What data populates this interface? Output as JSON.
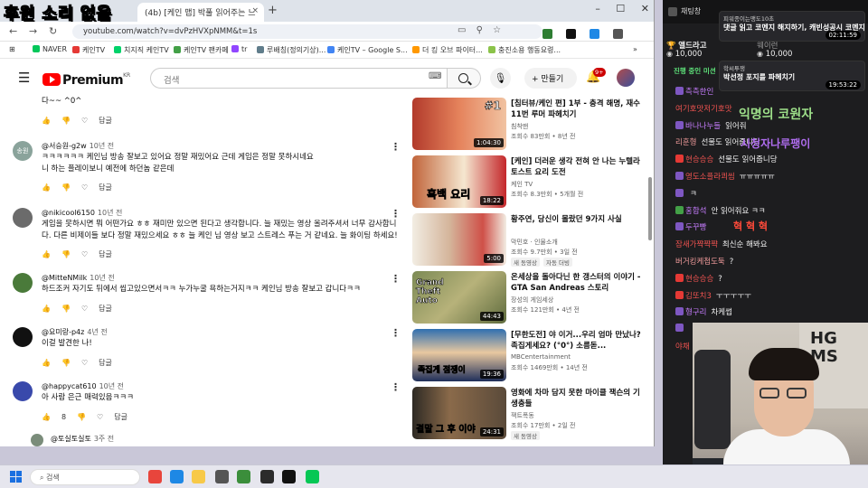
{
  "stream_title": "후원 소리 없음",
  "browser": {
    "tabs": [
      {
        "label": "",
        "close": "×"
      },
      {
        "label": "(4b) [케인 맵] 박풀 읽어주는 느",
        "close": "×"
      }
    ],
    "new_tab": "+",
    "window_controls": [
      "–",
      "☐",
      "✕"
    ],
    "url": "youtube.com/watch?v=dvPzHVXpNMM&t=1s",
    "bookmarks": [
      {
        "label": "NAVER",
        "color": "#03c75a"
      },
      {
        "label": "케인TV",
        "color": "#e53935"
      },
      {
        "label": "치지직 케인TV",
        "color": "#00d26a"
      },
      {
        "label": "케인TV 팬카페",
        "color": "#43a047"
      },
      {
        "label": "tr",
        "color": "#9146ff"
      },
      {
        "label": "루배칭(정의기상)...",
        "color": "#607d8b"
      },
      {
        "label": "케인TV – Google S...",
        "color": "#4285f4"
      },
      {
        "label": "더 킹 오브 파이터...",
        "color": "#ff9800"
      },
      {
        "label": "충진소용 행동요령...",
        "color": "#8bc34a"
      }
    ]
  },
  "youtube": {
    "logo_word": "Premium",
    "logo_region": "KR",
    "search_placeholder": "검색",
    "create_label": "+ 만들기",
    "notif_badge": "9+",
    "like_label": "👍",
    "reply_label": "답글",
    "comments": [
      {
        "author": "",
        "time": "",
        "text": "다~~ ^0^",
        "likes": ""
      },
      {
        "author": "@서승원-g2w",
        "time": "10년 전",
        "text": "ㅋㅋㅋㅋㅋㅋ 케인님 방송 잘보고 있어요 정말 재밌어요 근데 게임은 정말 못하시네요\n니 하는 플레이보니 예전에 하던놈 같은데",
        "likes": ""
      },
      {
        "author": "@nikicool6150",
        "time": "10년 전",
        "text": "게임을 못하시면 뭐 어떤가요 ㅎㅎ 재미만 있으면 된다고 생각합니다. 늘 재밌는 영상 올려주셔서 너무 감사합니다. 다른 비제이들 보다 정말 재밌으세요 ㅎㅎ 늘 케인 님 영상 보고 스트레스 푸는 거 같네요. 늘 화이팅 하세요!",
        "likes": ""
      },
      {
        "author": "@MitteNMilk",
        "time": "10년 전",
        "text": "하드조커 자기도 뒤에서 씹고있으면서ㅋㅋ 누가누굴 욕하는거지ㅋㅋ 케인님 방송 잘보고 갑니다ㅋㅋ",
        "likes": ""
      },
      {
        "author": "@요미랑-p4z",
        "time": "4년 전",
        "text": "이걸 발견한 나!",
        "likes": ""
      },
      {
        "author": "@happycat610",
        "time": "10년 전",
        "text": "아 사람 은근 매력있음ㅋㅋㅋ",
        "likes": "8"
      },
      {
        "author": "@토실토실토",
        "time": "3주 전",
        "text": "",
        "likes": ""
      }
    ],
    "recommendations": [
      {
        "title": "[침터뷰/케인 편] 1부 - 충격 해명, 재수 11번 루머 파헤치기",
        "channel": "침착맨",
        "meta": "조회수 83만회 • 8년 전",
        "duration": "1:04:30",
        "thumb_text": "#1",
        "badges": []
      },
      {
        "title": "[케인] 더러운 생각 전혀 안 나는 누텔라 토스트 요리 도전",
        "channel": "케인 TV",
        "meta": "조회수 8.3만회 • 5개월 전",
        "duration": "18:22",
        "thumb_text": "흑백 요리",
        "badges": []
      },
      {
        "title": "황주연, 당신이 몰랐던 9가지 사실",
        "channel": "막민호 · 인물소개",
        "meta": "조회수 9.7만회 • 3일 전",
        "duration": "5:00",
        "thumb_text": "",
        "badges": [
          "새 동영상",
          "자동 더빙"
        ]
      },
      {
        "title": "온세상을 돌아다닌 한 갱스터의 이야기 - GTA San Andreas 스토리",
        "channel": "장성의 게임세상",
        "meta": "조회수 121만회 • 4년 전",
        "duration": "44:43",
        "thumb_text": "Grand Theft Auto",
        "badges": []
      },
      {
        "title": "[무한도전] 야 이거...우리 엄마 만났나? 족집게세요? (°0°) 소름돋...",
        "channel": "MBCentertainment",
        "meta": "조회수 1469만회 • 14년 전",
        "duration": "19:36",
        "thumb_text": "족집게 점쟁이",
        "badges": []
      },
      {
        "title": "영화에 차마 담지 못한 마이클 잭슨의 기생충들",
        "channel": "잭트폭동",
        "meta": "조회수 17만회 • 2일 전",
        "duration": "24:31",
        "thumb_text": "결말 그 후 이야",
        "badges": [
          "새 동영상"
        ]
      }
    ]
  },
  "taskbar": {
    "search_placeholder": "검색",
    "apps": [
      {
        "name": "chrome",
        "color": "#e8453c"
      },
      {
        "name": "edge",
        "color": "#1e88e5"
      },
      {
        "name": "explorer",
        "color": "#f7c948"
      },
      {
        "name": "photos",
        "color": "#555555"
      },
      {
        "name": "notes",
        "color": "#3b8e3b"
      },
      {
        "name": "obs",
        "color": "#2b2b2b"
      },
      {
        "name": "soop",
        "color": "#111111"
      },
      {
        "name": "line",
        "color": "#06c755"
      }
    ]
  },
  "chat": {
    "header": "채팅창",
    "pinned": [
      {
        "name": "피워종이는맹도10초",
        "msg": "댓글 읽고 코멘지 해지하기, 캐빈성공시 코멘지",
        "time": "02:11:59"
      },
      {
        "name": "학씨투쟁",
        "msg": "박선정 포지를 파헤치기",
        "time": "19:53:22"
      }
    ],
    "donors": [
      {
        "name": "앨드라고",
        "amount": "10,000"
      },
      {
        "name": "웨이런",
        "amount": ""
      },
      {
        "name": "",
        "amount": "10,000"
      }
    ],
    "now_tag": "진행 중인 미션",
    "messages": [
      {
        "name": "측측한인",
        "msg": "",
        "color": "#c77dff",
        "icon": "#7e57c2"
      },
      {
        "name": "여기호맛저기호맛",
        "msg": "",
        "color": "#ef5350",
        "icon": ""
      },
      {
        "name": "바나나누들",
        "msg": "읽어줘",
        "color": "#c77dff",
        "icon": "#7e57c2"
      },
      {
        "name": "리훈형",
        "msg": "선물도 읽어줍니당",
        "color": "#ef9a9a",
        "icon": ""
      },
      {
        "name": "현승승승",
        "msg": "선물도 읽어줍니당",
        "color": "#ef5350",
        "icon": "#e53935"
      },
      {
        "name": "영도소플라쾨씸",
        "msg": "ㅠㅠㅠㅠㅠ",
        "color": "#ef5350",
        "icon": "#7e57c2"
      },
      {
        "name": "",
        "msg": "ㅋ",
        "color": "#c77dff",
        "icon": "#7e57c2"
      },
      {
        "name": "홍합석",
        "msg": "안 읽어줘요 ㅋㅋ",
        "color": "#c77dff",
        "icon": "#43a047"
      },
      {
        "name": "두꾸빵",
        "msg": "",
        "color": "#c77dff",
        "icon": "#7e57c2"
      },
      {
        "name": "잠새가쨕쨕쨕",
        "msg": "최신순 해봐요",
        "color": "#ef5350",
        "icon": ""
      },
      {
        "name": "버거킹케첩도둑",
        "msg": "?",
        "color": "#ef9a9a",
        "icon": ""
      },
      {
        "name": "현승승승",
        "msg": "?",
        "color": "#ef5350",
        "icon": "#e53935"
      },
      {
        "name": "김또치3",
        "msg": "ㅜㅜㅜㅜㅜ",
        "color": "#ef5350",
        "icon": "#e53935"
      },
      {
        "name": "형구리",
        "msg": "차케썹",
        "color": "#c77dff",
        "icon": "#7e57c2"
      },
      {
        "name": "",
        "msg": "",
        "color": "#c77dff",
        "icon": "#7e57c2"
      },
      {
        "name": "야채",
        "msg": "",
        "color": "#ef5350",
        "icon": ""
      }
    ],
    "overlays": {
      "guest": "익명의 코원자",
      "guest_msg": "시청자나루팽이",
      "hyuk": "혁 혁 혁",
      "chuckchuck": "측측한인"
    }
  },
  "webcam": {
    "poster_text": "HG\nMS"
  }
}
